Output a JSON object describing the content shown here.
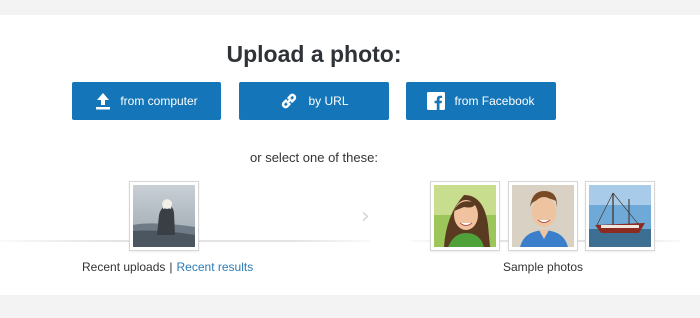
{
  "upload": {
    "title": "Upload a photo:",
    "buttons": [
      {
        "label": "from computer",
        "icon": "upload-arrow-icon"
      },
      {
        "label": "by URL",
        "icon": "link-icon"
      },
      {
        "label": "from Facebook",
        "icon": "facebook-icon"
      }
    ],
    "select_text": "or select one of these:"
  },
  "recent": {
    "uploads_label": "Recent uploads",
    "separator": "|",
    "results_label": "Recent results"
  },
  "samples": {
    "label": "Sample photos"
  },
  "nav": {
    "next_glyph": "›"
  },
  "colors": {
    "button_bg": "#1476b8",
    "link": "#2b7ab6",
    "page_bg": "#f3f3f3"
  }
}
